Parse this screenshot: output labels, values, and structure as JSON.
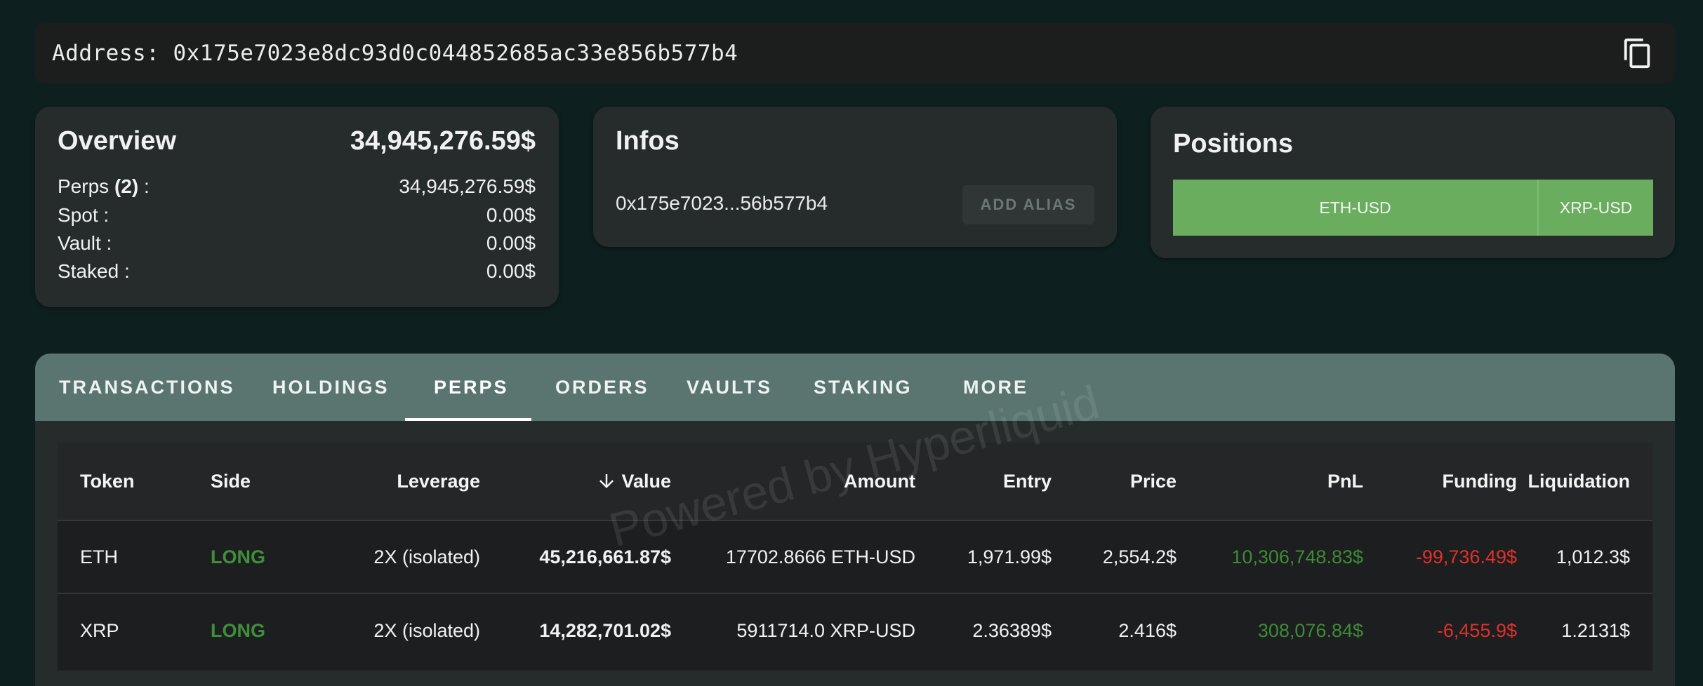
{
  "address": {
    "text": "Address: 0x175e7023e8dc93d0c044852685ac33e856b577b4",
    "copy_icon": "copy-icon"
  },
  "overview": {
    "title": "Overview",
    "total": "34,945,276.59$",
    "rows": [
      {
        "label_prefix": "Perps ",
        "label_count": "(2)",
        "label_suffix": " :",
        "value": "34,945,276.59$"
      },
      {
        "label": "Spot :",
        "value": "0.00$"
      },
      {
        "label": "Vault :",
        "value": "0.00$"
      },
      {
        "label": "Staked :",
        "value": "0.00$"
      }
    ]
  },
  "infos": {
    "title": "Infos",
    "short_address": "0x175e7023...56b577b4",
    "add_alias_label": "ADD ALIAS"
  },
  "positions": {
    "title": "Positions",
    "segments": [
      {
        "label": "ETH-USD"
      },
      {
        "label": "XRP-USD"
      }
    ],
    "color": "#6aad5e"
  },
  "tabs": [
    {
      "label": "TRANSACTIONS"
    },
    {
      "label": "HOLDINGS"
    },
    {
      "label": "PERPS",
      "active": true
    },
    {
      "label": "ORDERS"
    },
    {
      "label": "VAULTS"
    },
    {
      "label": "STAKING"
    },
    {
      "label": "MORE"
    }
  ],
  "table": {
    "columns": [
      "Token",
      "Side",
      "Leverage",
      "Value",
      "Amount",
      "Entry",
      "Price",
      "PnL",
      "Funding",
      "Liquidation"
    ],
    "sort_icon": "arrow-down-icon",
    "rows": [
      {
        "token": "ETH",
        "side": "LONG",
        "leverage": "2X (isolated)",
        "value": "45,216,661.87$",
        "amount": "17702.8666 ETH-USD",
        "entry": "1,971.99$",
        "price": "2,554.2$",
        "pnl": "10,306,748.83$",
        "funding": "-99,736.49$",
        "liquidation": "1,012.3$"
      },
      {
        "token": "XRP",
        "side": "LONG",
        "leverage": "2X (isolated)",
        "value": "14,282,701.02$",
        "amount": "5911714.0 XRP-USD",
        "entry": "2.36389$",
        "price": "2.416$",
        "pnl": "308,076.84$",
        "funding": "-6,455.9$",
        "liquidation": "1.2131$"
      }
    ]
  },
  "watermark": "Powered by Hyperliquid",
  "colors": {
    "background": "#0d1f1e",
    "card": "#262b2b",
    "tabbar": "#5a7570",
    "positive": "#3e8a36",
    "negative": "#e0302b"
  }
}
